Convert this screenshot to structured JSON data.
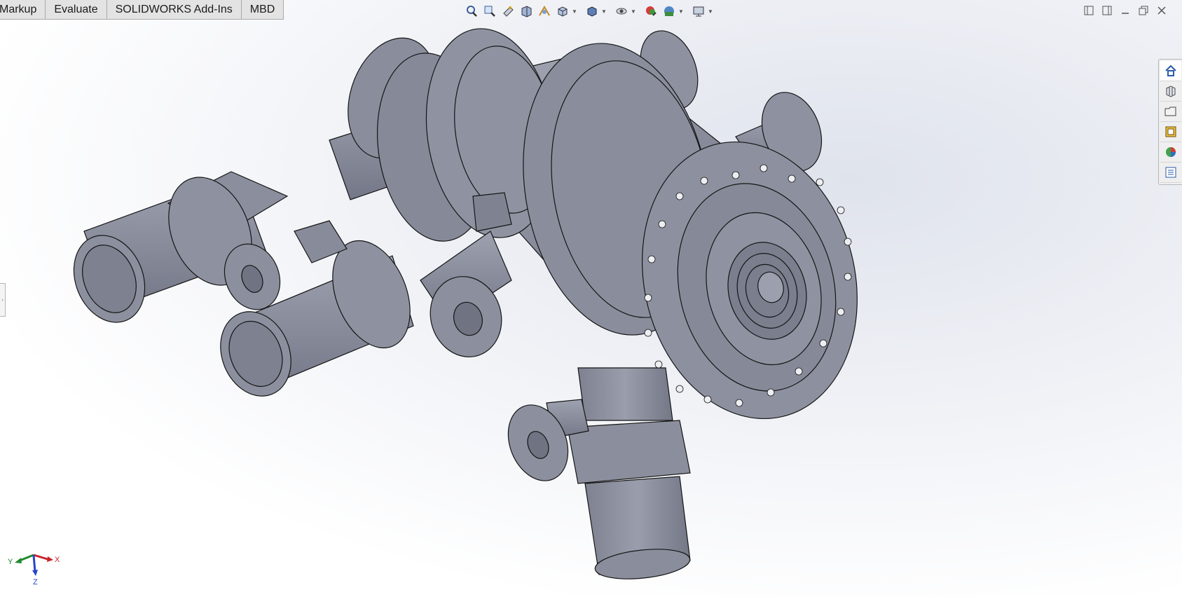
{
  "tabs": [
    "Markup",
    "Evaluate",
    "SOLIDWORKS Add-Ins",
    "MBD"
  ],
  "heads_up_toolbar": [
    "zoom-to-fit-icon",
    "zoom-to-area-icon",
    "previous-view-icon",
    "section-view-icon",
    "dynamic-annotation-icon",
    "view-orientation-icon",
    "display-style-icon",
    "hide-show-items-icon",
    "edit-appearance-icon",
    "apply-scene-icon",
    "view-settings-icon"
  ],
  "taskpane": [
    "home-icon",
    "design-library-icon",
    "file-explorer-icon",
    "view-palette-icon",
    "appearances-icon",
    "custom-properties-icon"
  ],
  "triad": {
    "x": "X",
    "y": "Y",
    "z": "Z"
  },
  "colors": {
    "part": "#8c909e",
    "part_dark": "#6f7382",
    "part_light": "#b4b8c5",
    "edge": "#151515",
    "axis_x": "#c8232c",
    "axis_y": "#1f8a2c",
    "axis_z": "#2a45c8"
  }
}
